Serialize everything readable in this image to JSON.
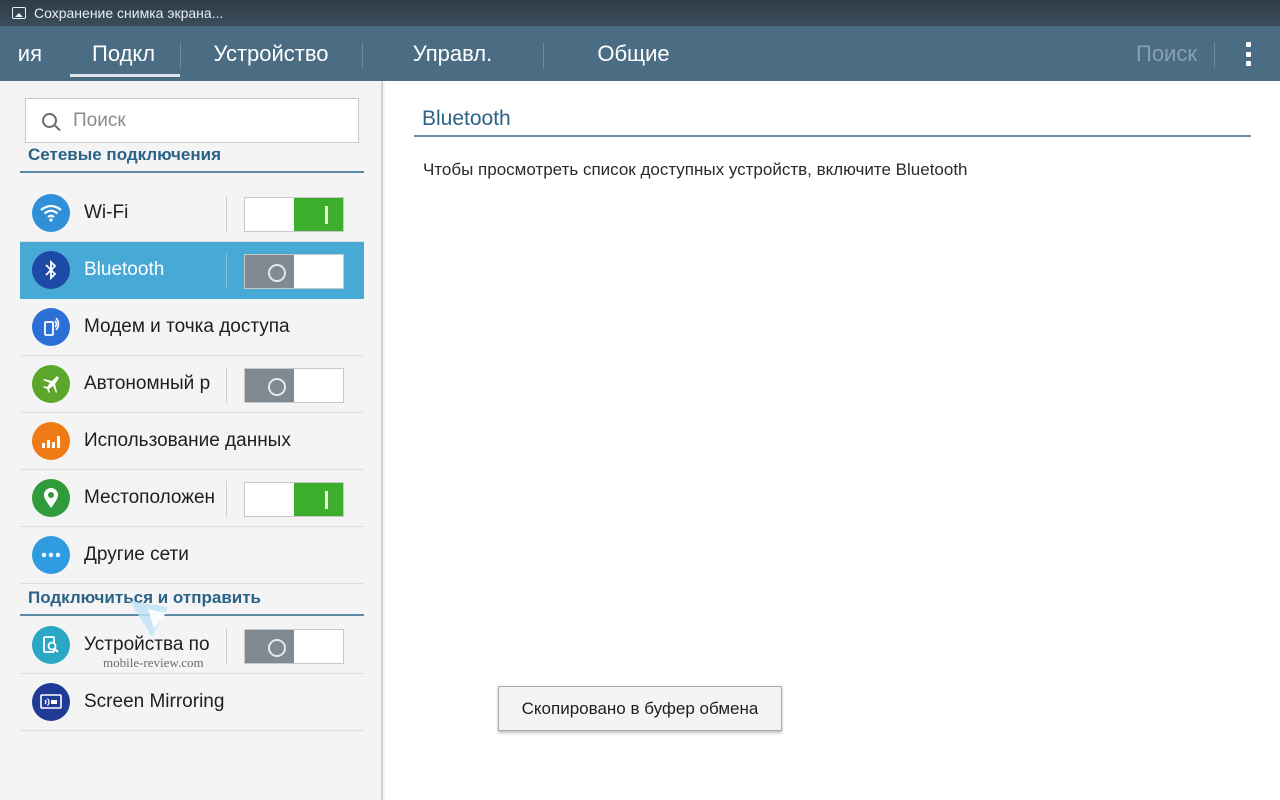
{
  "status_bar": {
    "notification": "Сохранение снимка экрана..."
  },
  "tabs": [
    {
      "label": "ия"
    },
    {
      "label": "Подкл"
    },
    {
      "label": "Устройство"
    },
    {
      "label": "Управл."
    },
    {
      "label": "Общие"
    }
  ],
  "action_bar": {
    "search_label": "Поиск",
    "menu_icon": "more-vert-icon"
  },
  "sidebar": {
    "search_placeholder": "Поиск",
    "sections": [
      {
        "title": "Сетевые подключения"
      },
      {
        "title": "Подключиться и отправить"
      }
    ],
    "items": [
      {
        "label": "Wi-Fi",
        "icon": "wifi-icon",
        "color": "#2f8fd8",
        "toggle": "on"
      },
      {
        "label": "Bluetooth",
        "icon": "bluetooth-icon",
        "color": "#1c4aa6",
        "toggle": "off",
        "selected": true
      },
      {
        "label": "Модем и точка доступа",
        "icon": "hotspot-icon",
        "color": "#2c6fd6"
      },
      {
        "label": "Автономный р",
        "icon": "airplane-icon",
        "color": "#5aa72b",
        "toggle": "off"
      },
      {
        "label": "Использование данных",
        "icon": "data-usage-icon",
        "color": "#f07a16"
      },
      {
        "label": "Местоположен",
        "icon": "location-icon",
        "color": "#2f9b3a",
        "toggle": "on"
      },
      {
        "label": "Другие сети",
        "icon": "more-networks-icon",
        "color": "#2f9be0"
      },
      {
        "label": "Устройства по",
        "icon": "nearby-devices-icon",
        "color": "#2aa7c4",
        "toggle": "off"
      },
      {
        "label": "Screen Mirroring",
        "icon": "screen-mirroring-icon",
        "color": "#1f3b95"
      }
    ]
  },
  "detail": {
    "title": "Bluetooth",
    "message": "Чтобы просмотреть список доступных устройств, включите Bluetooth"
  },
  "toast": {
    "text": "Скопировано в буфер обмена"
  },
  "watermark": {
    "text": "mobile-review.com"
  }
}
